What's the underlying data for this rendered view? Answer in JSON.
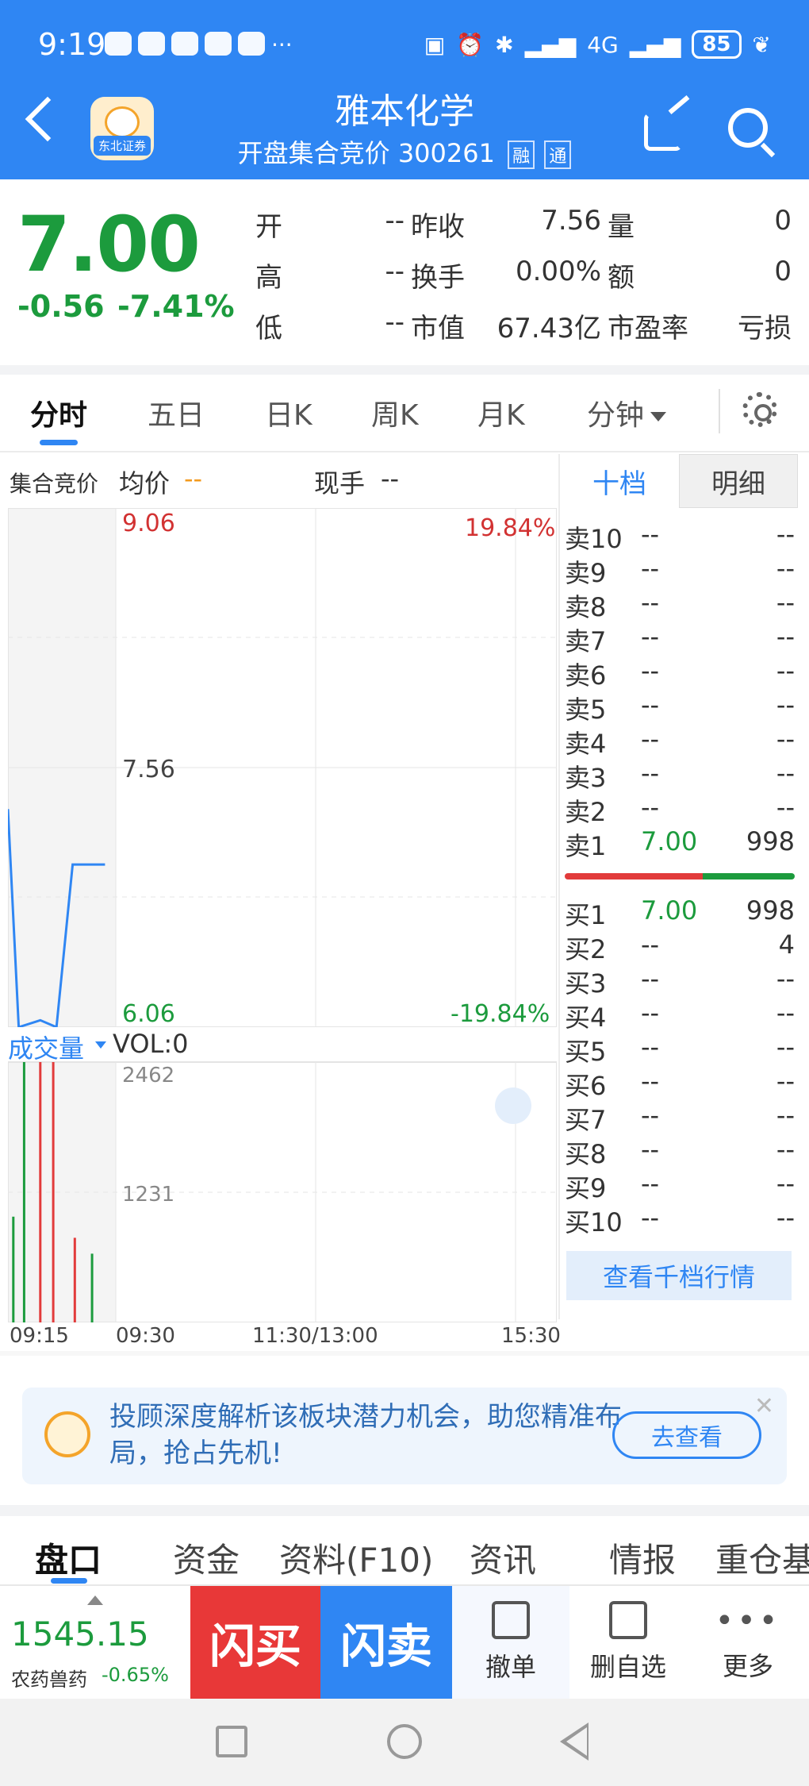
{
  "status_bar": {
    "time": "9:19",
    "more": "···",
    "network": "4G",
    "battery": "85"
  },
  "header": {
    "title": "雅本化学",
    "subtitle": "开盘集合竞价 300261",
    "tag_rong": "融",
    "tag_tong": "通",
    "logo_text": "东北证券"
  },
  "quote": {
    "price": "7.00",
    "change": "-0.56",
    "change_pct": "-7.41%",
    "fields": [
      {
        "label": "开",
        "value": "--"
      },
      {
        "label": "高",
        "value": "--"
      },
      {
        "label": "低",
        "value": "--"
      },
      {
        "label": "昨收",
        "value": "7.56"
      },
      {
        "label": "换手",
        "value": "0.00%"
      },
      {
        "label": "市值",
        "value": "67.43亿"
      },
      {
        "label": "量",
        "value": "0"
      },
      {
        "label": "额",
        "value": "0"
      },
      {
        "label": "市盈率",
        "value": "亏损"
      }
    ]
  },
  "tabs": [
    "分时",
    "五日",
    "日K",
    "周K",
    "月K",
    "分钟"
  ],
  "chart_header": {
    "auction_label": "集合竞价",
    "avg_label": "均价",
    "avg_value": "--",
    "now_label": "现手",
    "now_value": "--",
    "volume_label": "成交量",
    "vol_text": "VOL:0"
  },
  "chart_data": {
    "type": "line",
    "price_axis": {
      "top": "9.06",
      "mid": "7.56",
      "bottom": "6.06",
      "top_pct": "19.84%",
      "bottom_pct": "-19.84%"
    },
    "volume_axis": {
      "top": "2462",
      "mid": "1231"
    },
    "x_ticks": [
      "09:15",
      "09:30",
      "11:30/13:00",
      "15:30"
    ],
    "colors": {
      "line": "#2f86f3",
      "up": "#e23b3b",
      "down": "#1c9b3d"
    },
    "auction_line": [
      {
        "x": 0,
        "y": 7.32
      },
      {
        "x": 0.1,
        "y": 6.06
      },
      {
        "x": 0.3,
        "y": 6.1
      },
      {
        "x": 0.45,
        "y": 6.06
      },
      {
        "x": 0.6,
        "y": 7.0
      },
      {
        "x": 0.9,
        "y": 7.0
      }
    ],
    "auction_volume": [
      {
        "x": 0.05,
        "v": 1000,
        "c": "down"
      },
      {
        "x": 0.15,
        "v": 2462,
        "c": "down"
      },
      {
        "x": 0.3,
        "v": 2462,
        "c": "up"
      },
      {
        "x": 0.42,
        "v": 2462,
        "c": "up"
      },
      {
        "x": 0.62,
        "v": 800,
        "c": "up"
      },
      {
        "x": 0.78,
        "v": 650,
        "c": "down"
      }
    ]
  },
  "order_book": {
    "tab_ten": "十档",
    "tab_detail": "明细",
    "asks": [
      {
        "label": "卖10",
        "price": "--",
        "vol": "--"
      },
      {
        "label": "卖9",
        "price": "--",
        "vol": "--"
      },
      {
        "label": "卖8",
        "price": "--",
        "vol": "--"
      },
      {
        "label": "卖7",
        "price": "--",
        "vol": "--"
      },
      {
        "label": "卖6",
        "price": "--",
        "vol": "--"
      },
      {
        "label": "卖5",
        "price": "--",
        "vol": "--"
      },
      {
        "label": "卖4",
        "price": "--",
        "vol": "--"
      },
      {
        "label": "卖3",
        "price": "--",
        "vol": "--"
      },
      {
        "label": "卖2",
        "price": "--",
        "vol": "--"
      },
      {
        "label": "卖1",
        "price": "7.00",
        "vol": "998"
      }
    ],
    "bids": [
      {
        "label": "买1",
        "price": "7.00",
        "vol": "998"
      },
      {
        "label": "买2",
        "price": "--",
        "vol": "4"
      },
      {
        "label": "买3",
        "price": "--",
        "vol": "--"
      },
      {
        "label": "买4",
        "price": "--",
        "vol": "--"
      },
      {
        "label": "买5",
        "price": "--",
        "vol": "--"
      },
      {
        "label": "买6",
        "price": "--",
        "vol": "--"
      },
      {
        "label": "买7",
        "price": "--",
        "vol": "--"
      },
      {
        "label": "买8",
        "price": "--",
        "vol": "--"
      },
      {
        "label": "买9",
        "price": "--",
        "vol": "--"
      },
      {
        "label": "买10",
        "price": "--",
        "vol": "--"
      }
    ],
    "view_more": "查看千档行情"
  },
  "banner": {
    "text": "投顾深度解析该板块潜力机会，助您精准布局，抢占先机!",
    "button": "去查看",
    "close": "✕"
  },
  "bottom_tabs": [
    "盘口",
    "资金",
    "资料(F10)",
    "资讯",
    "情报",
    "重仓基"
  ],
  "index": {
    "value": "1545.15",
    "name": "农药兽药",
    "change": "-0.65%"
  },
  "actions": {
    "buy": "闪买",
    "sell": "闪卖",
    "cancel": "撤单",
    "remove": "删自选",
    "more": "更多"
  }
}
